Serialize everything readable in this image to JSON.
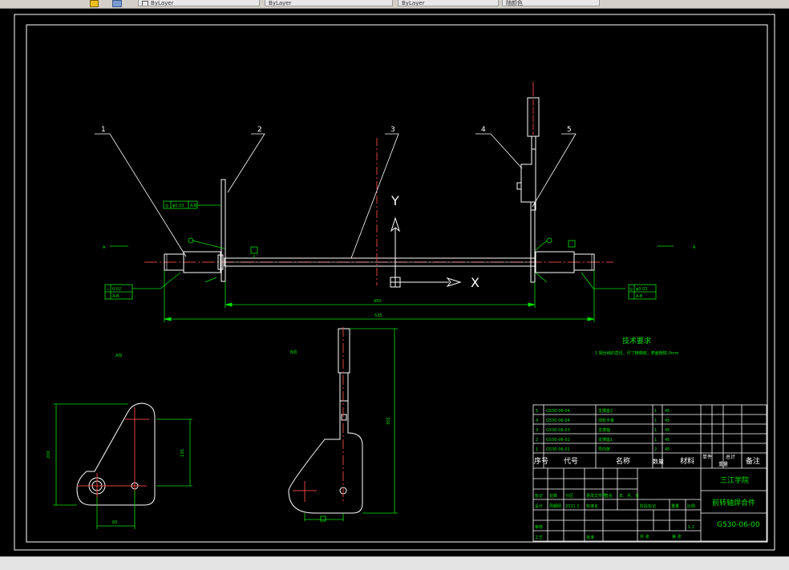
{
  "toolbar": {
    "tabs": [
      {
        "label": "ByLayer"
      },
      {
        "label": "ByLayer"
      },
      {
        "label": "ByLayer"
      },
      {
        "label": "随颜色"
      }
    ]
  },
  "drawing": {
    "leaders": [
      "1",
      "2",
      "3",
      "4",
      "5"
    ],
    "axis_y": "Y",
    "axis_x": "X",
    "dim_inner": "450",
    "dim_outer": "535",
    "dim_bracket_height": "200",
    "dim_bracket_width": "60",
    "dim_bracket_inner": "130",
    "dim_bar_height": "355",
    "view_a": "A向",
    "view_b": "B向",
    "marker_a_left": "A",
    "marker_a_right": "A",
    "tech_title": "技术要求",
    "tech_text": "1.钢丝绳的直径，尺寸精确度，表面粗糙-0mm",
    "fcf_left_top": [
      "◎",
      "φ0.03",
      "A-B"
    ],
    "fcf_left_bottom": [
      "⊥",
      "0.02",
      "A-B"
    ],
    "fcf_right": [
      "◎",
      "φ0.03",
      "A-B"
    ],
    "datum_label": "A"
  },
  "title_block": {
    "bom_rows": [
      {
        "no": "5",
        "code": "G530-06-04",
        "name": "支撑座2",
        "qty": "1",
        "mat": "45"
      },
      {
        "no": "4",
        "code": "G530-06-04",
        "name": "前轮平板",
        "qty": "1",
        "mat": "45"
      },
      {
        "no": "3",
        "code": "G530-06-03",
        "name": "支撑轴",
        "qty": "1",
        "mat": "45"
      },
      {
        "no": "2",
        "code": "G530-06-02",
        "name": "支撑座1",
        "qty": "1",
        "mat": "45"
      },
      {
        "no": "1",
        "code": "G530-06-01",
        "name": "导向架",
        "qty": "2",
        "mat": "45"
      }
    ],
    "headers": {
      "no": "序号",
      "code": "代号",
      "name": "名称",
      "qty": "数量",
      "mat": "材料",
      "unit": "单件",
      "total": "总计",
      "weight": "重量",
      "note": "备注"
    },
    "school": "三江学院",
    "part_name": "前转轴焊合件",
    "drawing_no": "G530-06-00",
    "scale_label": "比例",
    "scale": "1:2",
    "stage_label": "阶段标记",
    "weight_label": "重量",
    "sheet_total": "共  张",
    "sheet_no": "第  张",
    "row_mark": [
      "标记",
      "处数",
      "分区",
      "更改文件号",
      "签名",
      "年、月、日"
    ],
    "row_design": [
      "设计",
      "周朝阳",
      "2021.1",
      "标准化"
    ],
    "row_review": "审核",
    "row_process": "工艺",
    "row_approve": "批准"
  }
}
